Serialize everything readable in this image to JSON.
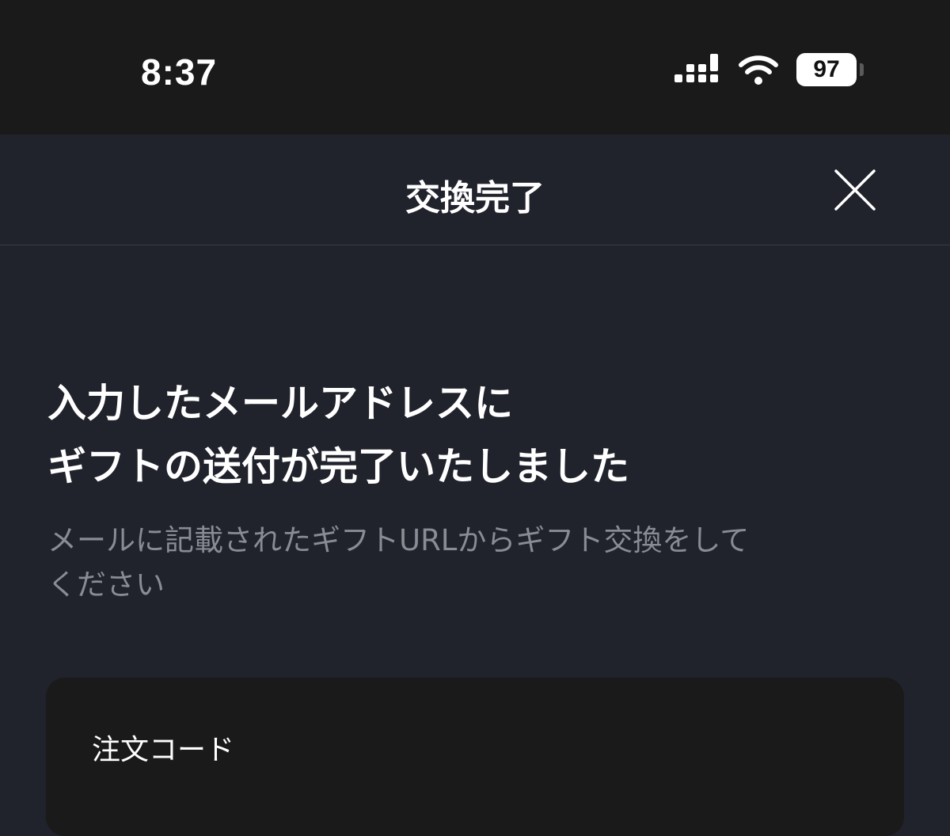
{
  "status_bar": {
    "time": "8:37",
    "battery_level": "97"
  },
  "nav": {
    "title": "交換完了",
    "close_icon": "close-icon"
  },
  "message": {
    "headline_line1": "入力したメールアドレスに",
    "headline_line2": "ギフトの送付が完了いたしました",
    "sub_line1": "メールに記載されたギフトURLからギフト交換をして",
    "sub_line2": "ください"
  },
  "card": {
    "label": "注文コード"
  },
  "colors": {
    "background": "#20222c",
    "status_bar": "#1a1a1a",
    "card": "#1a1a1a",
    "text_primary": "#ffffff",
    "text_secondary": "#8a8c94"
  }
}
